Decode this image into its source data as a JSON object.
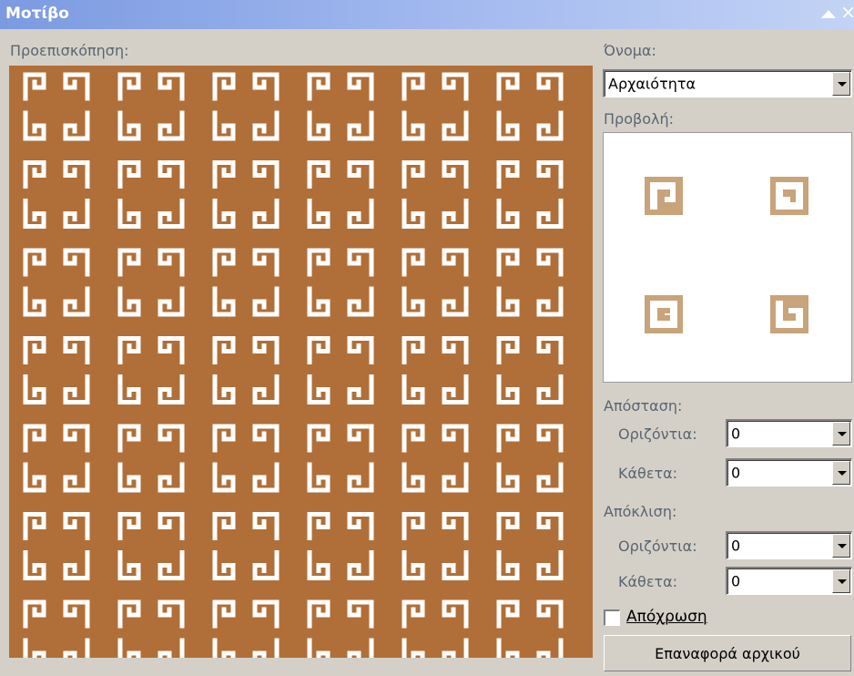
{
  "window": {
    "title": "Μοτίβο",
    "collapse_icon": "triangle-up-icon",
    "close_icon": "close-icon"
  },
  "preview": {
    "label": "Προεπισκόπηση:",
    "background_color": "#b06f38",
    "pattern_color": "#ffffff",
    "pattern_icon": "greek-key-meander-icon"
  },
  "name": {
    "label": "Όνομα:",
    "value": "Αρχαιότητα"
  },
  "view": {
    "label": "Προβολή:",
    "tile_color": "#c9a37a",
    "tile_icon": "greek-key-spiral-icon"
  },
  "spacing": {
    "label": "Απόσταση:",
    "horizontal_label": "Οριζόντια:",
    "horizontal_value": "0",
    "vertical_label": "Κάθετα:",
    "vertical_value": "0"
  },
  "offset": {
    "label": "Απόκλιση:",
    "horizontal_label": "Οριζόντια:",
    "horizontal_value": "0",
    "vertical_label": "Κάθετα:",
    "vertical_value": "0"
  },
  "tint": {
    "label": "Απόχρωση",
    "checked": false
  },
  "reset_button": {
    "label": "Επαναφορά αρχικού"
  }
}
